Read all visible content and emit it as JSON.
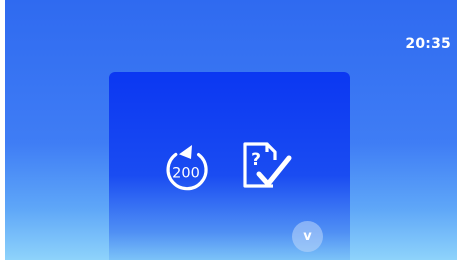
{
  "status_bar": {
    "time": "20:35"
  },
  "card": {
    "rotate_icon": {
      "icon": "counter-rotate-icon",
      "value": "200"
    },
    "check_icon": {
      "icon": "document-question-check-icon",
      "symbol": "?"
    },
    "expand_button": {
      "icon": "chevron-down-icon",
      "label": "v"
    }
  },
  "colors": {
    "background_top": "#2f6af0",
    "background_bottom": "#8ed3fb",
    "card_top": "#0b37f2",
    "card_bottom": "#7cc3f8",
    "foreground": "#ffffff"
  }
}
